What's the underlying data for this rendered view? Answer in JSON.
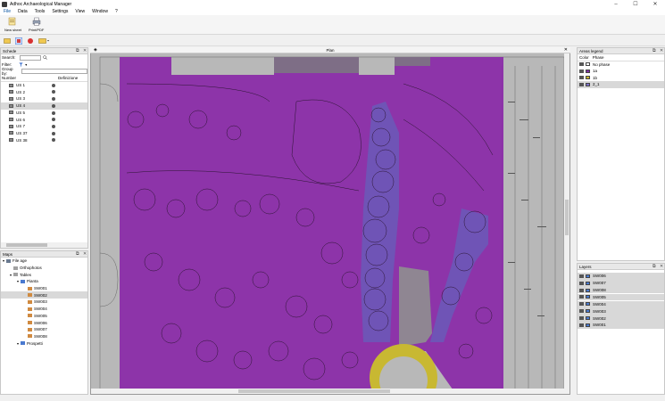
{
  "window": {
    "title": "Adhoc Archaeological Manager",
    "controls": [
      "–",
      "☐",
      "✕"
    ]
  },
  "menu": [
    "File",
    "Data",
    "Tools",
    "Settings",
    "View",
    "Window",
    "?"
  ],
  "ribbon": {
    "new_sheet": "New sheet",
    "print_pdf": "Print/PDF"
  },
  "schede": {
    "title": "Schede",
    "search_label": "Search:",
    "filter_label": "Filter:",
    "group_by_label": "Group by:",
    "col_number": "Number",
    "col_definition": "Definizione",
    "rows": [
      "US 1",
      "US 2",
      "US 3",
      "US 4",
      "US 5",
      "US 6",
      "US 7",
      "US 37",
      "US 38"
    ],
    "selected_index": 3
  },
  "maps": {
    "title": "Maps",
    "tree": [
      {
        "label": "File age",
        "level": 0,
        "type": "root"
      },
      {
        "label": "Orthophotos",
        "level": 1,
        "type": "folder"
      },
      {
        "label": "Tables",
        "level": 1,
        "type": "folder"
      },
      {
        "label": "Pianta",
        "level": 2,
        "type": "folder-blue"
      },
      {
        "label": "SW001",
        "level": 3,
        "type": "file"
      },
      {
        "label": "SW002",
        "level": 3,
        "type": "file",
        "selected": true
      },
      {
        "label": "SW003",
        "level": 3,
        "type": "file"
      },
      {
        "label": "SW004",
        "level": 3,
        "type": "file"
      },
      {
        "label": "SW005",
        "level": 3,
        "type": "file"
      },
      {
        "label": "SW006",
        "level": 3,
        "type": "file"
      },
      {
        "label": "SW007",
        "level": 3,
        "type": "file"
      },
      {
        "label": "SW008",
        "level": 3,
        "type": "file"
      },
      {
        "label": "Prospetti",
        "level": 2,
        "type": "folder-blue"
      }
    ]
  },
  "plan": {
    "title": "Plan"
  },
  "areas_legend": {
    "title": "Areas legend",
    "col_color": "Color",
    "col_phase": "Phase",
    "rows": [
      {
        "label": "No phase",
        "color": "#ffffff"
      },
      {
        "label": "1a",
        "color": "#7b2fa0"
      },
      {
        "label": "1b",
        "color": "#c9b42a"
      },
      {
        "label": "2_1",
        "color": "#7b6fc8"
      }
    ],
    "selected_index": 3
  },
  "layers": {
    "title": "Layers",
    "rows": [
      "SW006",
      "SW007",
      "SW008",
      "SW005",
      "SW004",
      "SW003",
      "SW002",
      "SW001"
    ]
  },
  "colors": {
    "purple_area": "#8a2aa8",
    "yellow_area": "#c8b832",
    "blue_area": "#6a5ab8",
    "gray_bg": "#bdbdbd"
  }
}
